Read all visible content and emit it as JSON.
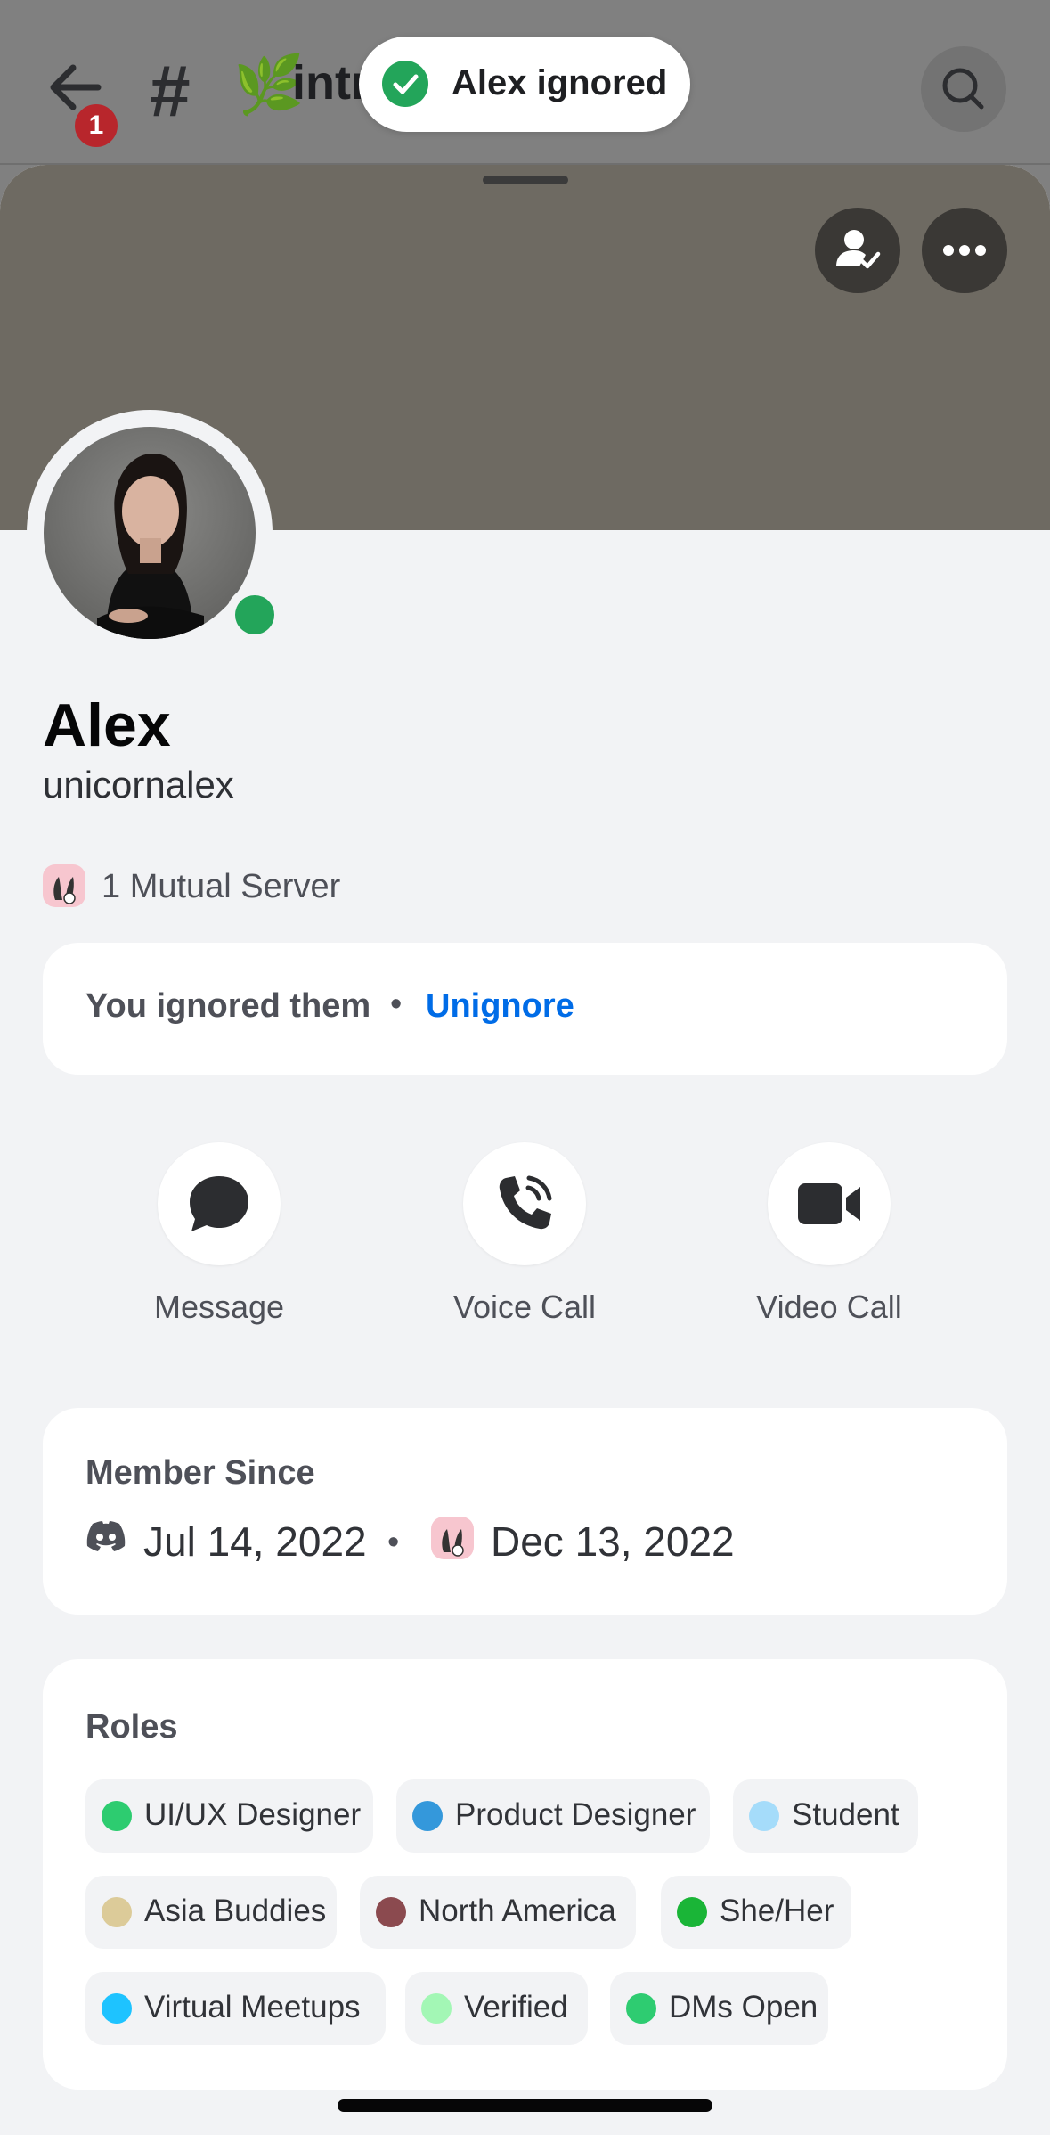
{
  "header": {
    "unread_badge": "1",
    "hash": "#",
    "channel_emoji": "🌿",
    "channel_name": "intr"
  },
  "toast": {
    "text": "Alex ignored"
  },
  "profile": {
    "display_name": "Alex",
    "username": "unicornalex",
    "status": "online",
    "mutual_servers": "1 Mutual Server"
  },
  "ignored": {
    "text": "You ignored them",
    "separator": "•",
    "action": "Unignore"
  },
  "actions": [
    {
      "label": "Message",
      "icon": "chat-bubble-icon"
    },
    {
      "label": "Voice Call",
      "icon": "phone-icon"
    },
    {
      "label": "Video Call",
      "icon": "video-camera-icon"
    }
  ],
  "member_since": {
    "title": "Member Since",
    "discord_date": "Jul 14, 2022",
    "separator": "•",
    "server_date": "Dec 13, 2022"
  },
  "roles": {
    "title": "Roles",
    "items": [
      {
        "label": "UI/UX Designer",
        "color": "#2dcc70"
      },
      {
        "label": "Product Designer",
        "color": "#3498db"
      },
      {
        "label": "Student",
        "color": "#a5dcfa"
      },
      {
        "label": "Asia Buddies",
        "color": "#dccb99"
      },
      {
        "label": "North America",
        "color": "#8b4a4f"
      },
      {
        "label": "She/Her",
        "color": "#1ab537"
      },
      {
        "label": "Virtual Meetups",
        "color": "#1ec3ff"
      },
      {
        "label": "Verified",
        "color": "#a3f7b5"
      },
      {
        "label": "DMs Open",
        "color": "#2ecc71"
      }
    ]
  },
  "colors": {
    "accent_link": "#006ce7",
    "online": "#23a55a",
    "badge_red": "#b8262c"
  }
}
